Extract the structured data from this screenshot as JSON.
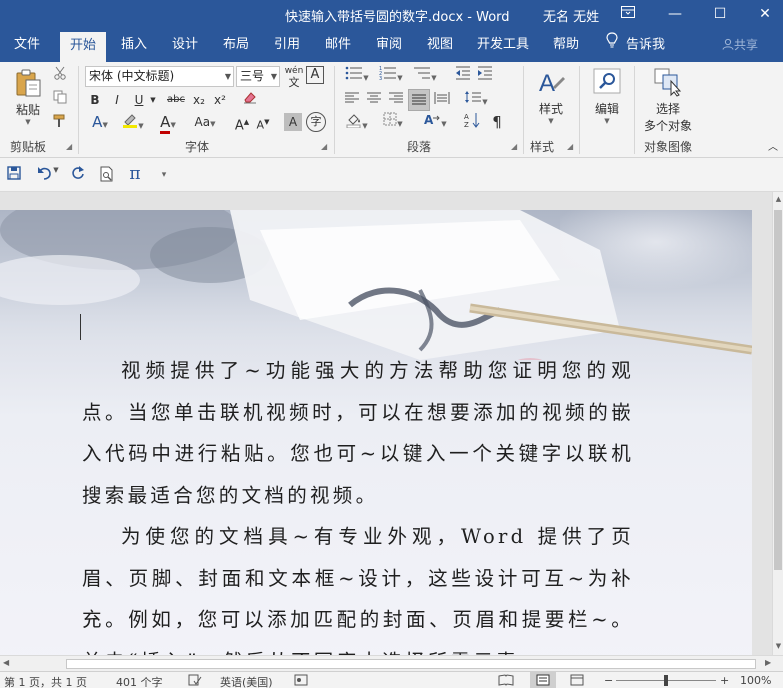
{
  "window": {
    "title": "快速输入带括号圆的数字.docx  -  Word",
    "user": "无名 无姓",
    "ribbon_display_icon": "ribbon-display-icon",
    "minimize": "—",
    "maximize": "☐",
    "close": "✕"
  },
  "tabs": [
    {
      "label": "文件"
    },
    {
      "label": "开始"
    },
    {
      "label": "插入"
    },
    {
      "label": "设计"
    },
    {
      "label": "布局"
    },
    {
      "label": "引用"
    },
    {
      "label": "邮件"
    },
    {
      "label": "审阅"
    },
    {
      "label": "视图"
    },
    {
      "label": "开发工具"
    },
    {
      "label": "帮助"
    }
  ],
  "tell_me": "告诉我",
  "share": "共享",
  "ribbon": {
    "clipboard": {
      "paste": "粘贴",
      "label": "剪贴板"
    },
    "font": {
      "name": "宋体 (中文标题)",
      "size": "三号",
      "phonetic": "wén",
      "bold": "B",
      "italic": "I",
      "underline": "U",
      "strike": "abc",
      "subscript": "x₂",
      "superscript": "x²",
      "grow": "A",
      "shrink": "A",
      "change_case": "Aa",
      "char_shading": "A",
      "enclose": "字",
      "label": "字体"
    },
    "paragraph": {
      "label": "段落"
    },
    "styles": {
      "button": "样式",
      "label": "样式"
    },
    "editing": {
      "button": "编辑"
    },
    "select": {
      "line1": "选择",
      "line2": "多个对象",
      "label": "对象图像"
    }
  },
  "document": {
    "paragraphs": [
      {
        "text": "视频提供了~功能强大的方法帮助您证明您的观点。当您单击联机视频时，可以在想要添加的视频的嵌入代码中进行粘贴。您也可~以键入一个关键字以联机搜索最适合您的文档的视频。"
      },
      {
        "text": "为使您的文档具~有专业外观，Word 提供了页眉、页脚、封面和文本框~设计，这些设计可互~为补充。例如，您可以添加匹配的封面、页眉和提要栏~。单击“插入”，然后从不同库中选择所需元素。"
      }
    ]
  },
  "status": {
    "page": "第 1 页，共 1 页",
    "words": "401 个字",
    "language": "英语(美国)",
    "zoom": "100%"
  },
  "colors": {
    "brand": "#2b579a"
  }
}
